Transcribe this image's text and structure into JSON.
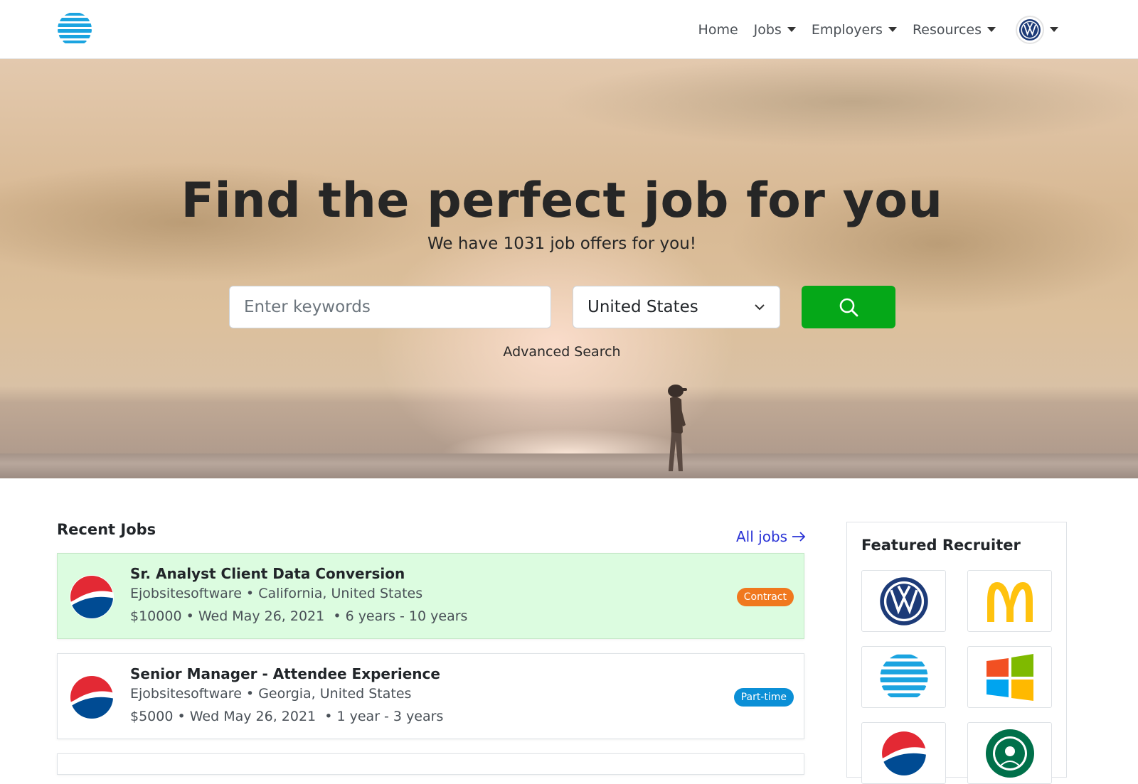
{
  "nav": {
    "brand_icon": "att-globe-logo",
    "items": [
      {
        "label": "Home",
        "dropdown": false
      },
      {
        "label": "Jobs",
        "dropdown": true
      },
      {
        "label": "Employers",
        "dropdown": true
      },
      {
        "label": "Resources",
        "dropdown": true
      }
    ],
    "avatar_icon": "volkswagen-logo"
  },
  "hero": {
    "title": "Find the perfect job for you",
    "subtitle": "We have 1031 job offers for you!",
    "keywords_placeholder": "Enter keywords",
    "country_value": "United States",
    "search_icon": "search-icon",
    "advanced_search": "Advanced Search",
    "search_button_color": "#05a818"
  },
  "recent_jobs": {
    "title": "Recent Jobs",
    "all_jobs_label": "All jobs",
    "jobs": [
      {
        "title": "Sr. Analyst Client Data Conversion",
        "company": "Ejobsitesoftware",
        "location": "California, United States",
        "salary": "$10000",
        "date": "Wed May 26, 2021",
        "experience": "6 years - 10 years",
        "type": "Contract",
        "type_color": "#f0781e",
        "logo": "pepsi-logo",
        "highlighted": true
      },
      {
        "title": "Senior Manager - Attendee Experience",
        "company": "Ejobsitesoftware",
        "location": "Georgia, United States",
        "salary": "$5000",
        "date": "Wed May 26, 2021",
        "experience": "1 year - 3 years",
        "type": "Part-time",
        "type_color": "#0b8fd6",
        "logo": "pepsi-logo",
        "highlighted": false
      }
    ]
  },
  "featured_recruiter": {
    "title": "Featured Recruiter",
    "logos": [
      "volkswagen-logo",
      "mcdonalds-logo",
      "att-logo",
      "microsoft-logo",
      "pepsi-logo",
      "starbucks-logo"
    ]
  }
}
